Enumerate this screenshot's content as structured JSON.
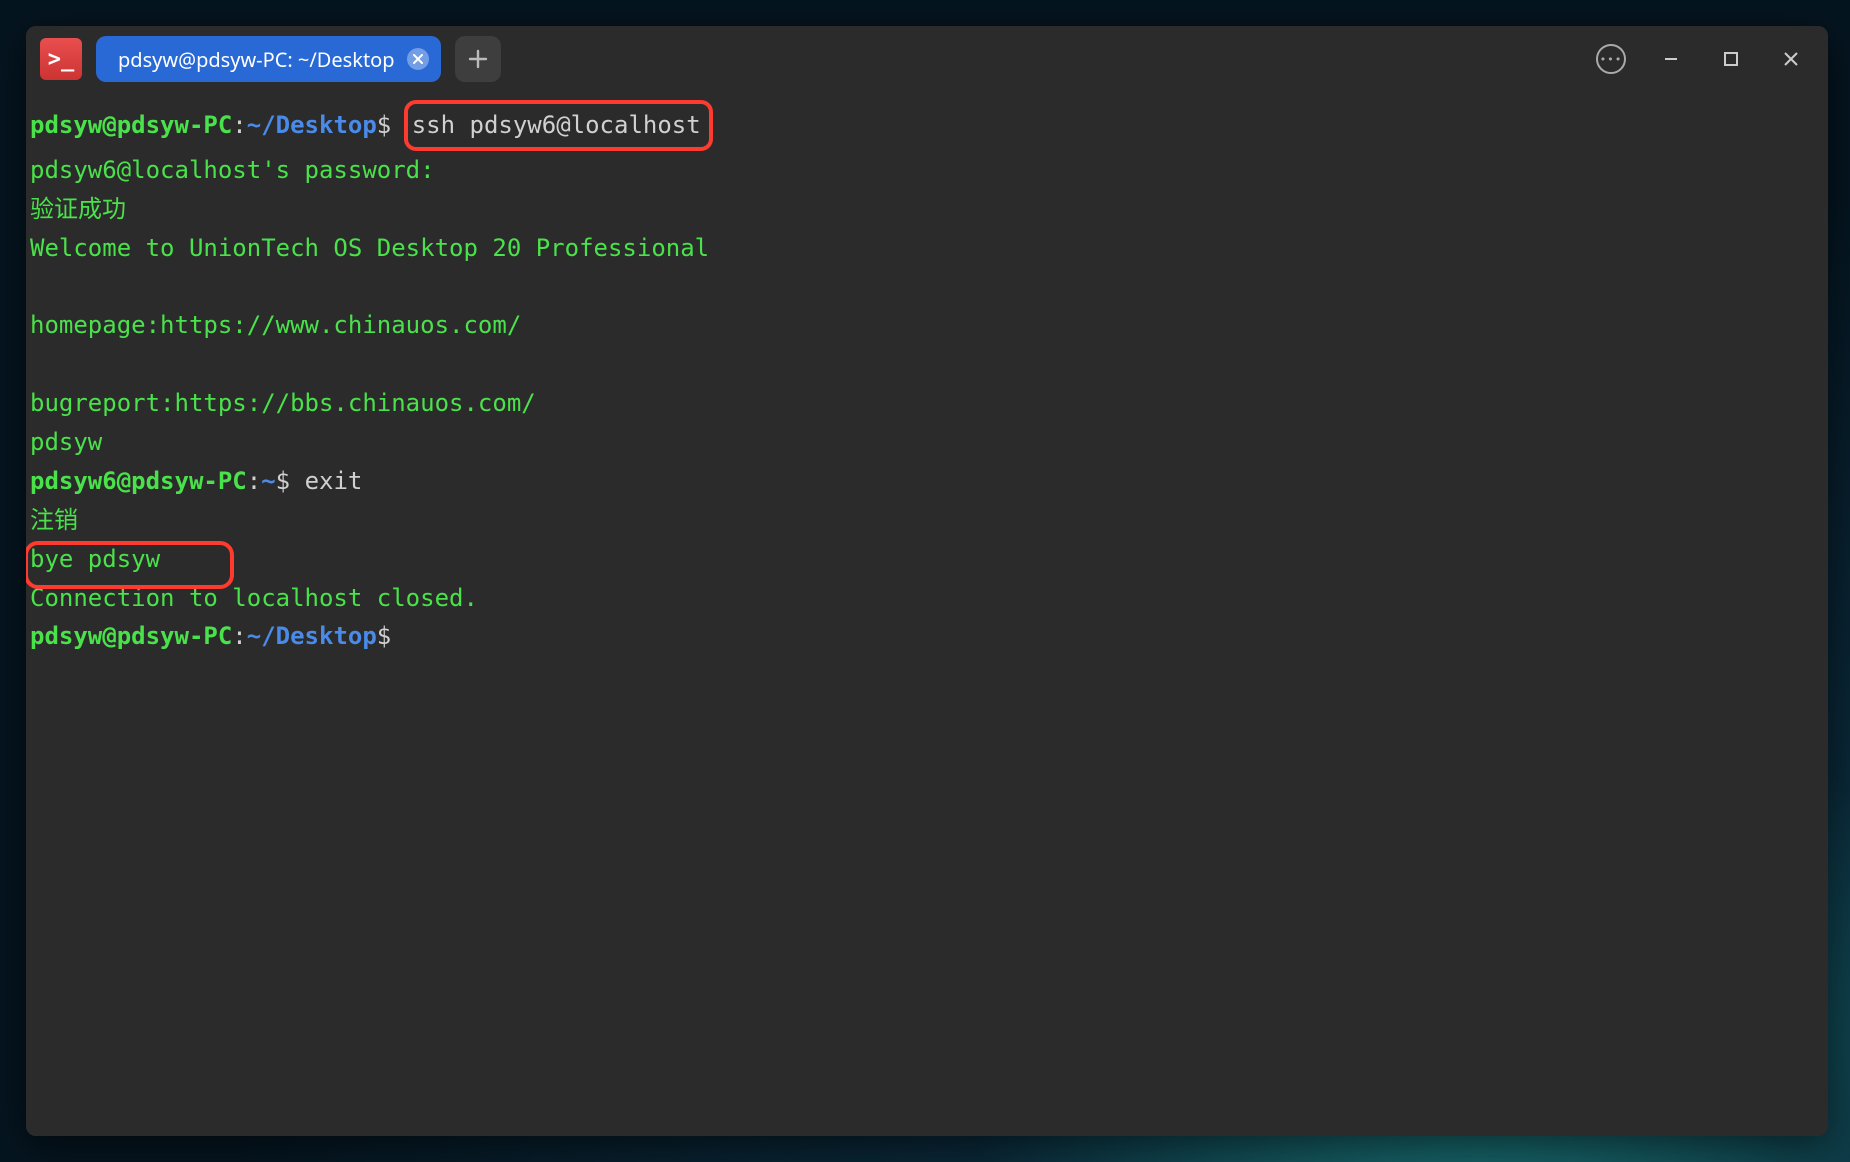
{
  "titlebar": {
    "tab_label": "pdsyw@pdsyw-PC: ~/Desktop"
  },
  "term": {
    "p1_user": "pdsyw@pdsyw-PC",
    "p1_path": "~/Desktop",
    "cmd1": "ssh pdsyw6@localhost",
    "l2": "pdsyw6@localhost's password:",
    "l3": "验证成功",
    "l4": "Welcome to UnionTech OS Desktop 20 Professional",
    "l5": "",
    "l6": "homepage:https://www.chinauos.com/",
    "l7": "",
    "l8": "bugreport:https://bbs.chinauos.com/",
    "l9": "pdsyw",
    "p2_user": "pdsyw6@pdsyw-PC",
    "p2_path": "~",
    "cmd2": "exit",
    "l11": "注销",
    "l12": "bye pdsyw",
    "l13": "Connection to localhost closed.",
    "p3_user": "pdsyw@pdsyw-PC",
    "p3_path": "~/Desktop"
  }
}
